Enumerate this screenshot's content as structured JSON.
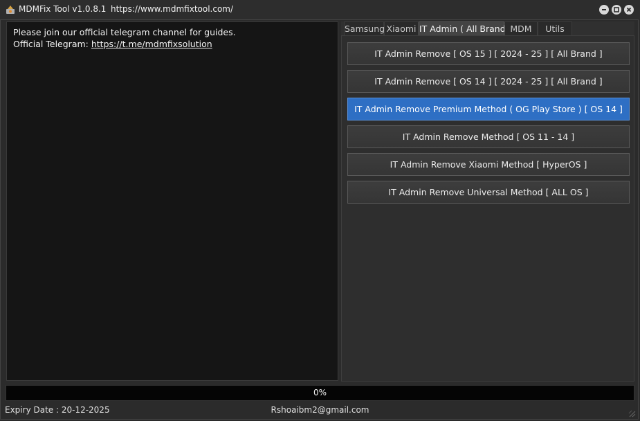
{
  "window": {
    "title": "MDMFix Tool v1.0.8.1",
    "url": "https://www.mdmfixtool.com/"
  },
  "log": {
    "line1": "Please join our official telegram channel for guides.",
    "telegram_label": "Official Telegram: ",
    "telegram_link": "https://t.me/mdmfixsolution"
  },
  "tabs": [
    {
      "label": "Samsung",
      "active": false
    },
    {
      "label": "Xiaomi",
      "active": false
    },
    {
      "label": "IT Admin ( All Brand )",
      "active": true
    },
    {
      "label": "MDM",
      "active": false
    },
    {
      "label": "Utils",
      "active": false
    }
  ],
  "buttons": [
    {
      "label": "IT Admin Remove  [ OS 15  ] [ 2024 - 25 ] [ All Brand ]",
      "highlighted": false
    },
    {
      "label": "IT Admin Remove  [ OS 14  ] [ 2024 - 25 ] [ All Brand ]",
      "highlighted": false
    },
    {
      "label": "IT Admin Remove Premium Method ( OG Play Store ) [ OS 14 ]",
      "highlighted": true
    },
    {
      "label": "IT Admin Remove Method [ OS 11 - 14 ]",
      "highlighted": false
    },
    {
      "label": "IT Admin Remove Xiaomi Method [ HyperOS ]",
      "highlighted": false
    },
    {
      "label": "IT Admin Remove Universal Method [ ALL OS ]",
      "highlighted": false
    }
  ],
  "progress": {
    "value": 0,
    "text": "0%"
  },
  "status": {
    "expiry": "Expiry Date : 20-12-2025",
    "email": "Rshoaibm2@gmail.com"
  },
  "colors": {
    "accent": "#2e6fc4",
    "background": "#2b2b2b",
    "log_background": "#151515"
  }
}
